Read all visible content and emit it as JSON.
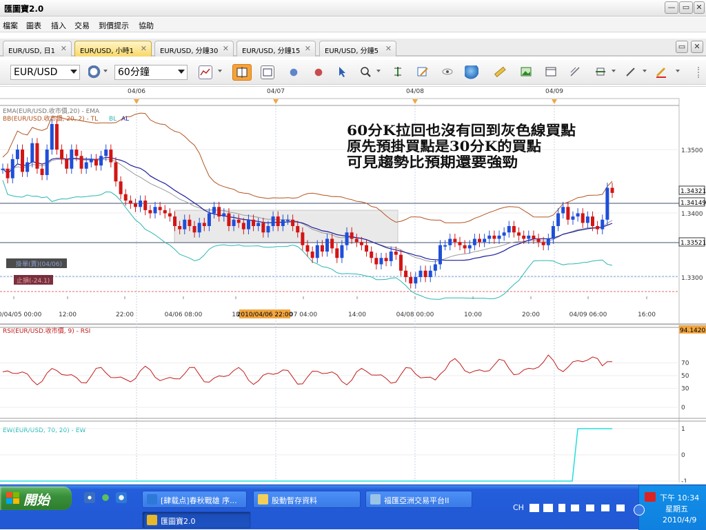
{
  "window": {
    "title": "匯圖寶2.0"
  },
  "menu": [
    "檔案",
    "圖表",
    "插入",
    "交易",
    "到價提示",
    "協助"
  ],
  "tabs": [
    {
      "label": "EUR/USD, 日1",
      "active": false
    },
    {
      "label": "EUR/USD, 小時1",
      "active": true
    },
    {
      "label": "EUR/USD, 分鐘30",
      "active": false
    },
    {
      "label": "EUR/USD, 分鐘15",
      "active": false
    },
    {
      "label": "EUR/USD, 分鐘5",
      "active": false
    }
  ],
  "toolbar": {
    "symbol": "EUR/USD",
    "period": "60分鐘"
  },
  "chart": {
    "top_dates": [
      "04/06",
      "04/07",
      "04/08",
      "04/09"
    ],
    "legend_ema": "EMA(EUR/USD.收市價,20) - EMA",
    "legend_bb": "BB(EUR/USD.收市價, 20, 2) - TL",
    "legend_bb_bl": "BL",
    "legend_bb_al": "AL",
    "annotation": [
      "60分K拉回也沒有回到灰色線買點",
      "原先預掛買點是30分K的買點",
      "可見趨勢比預期還要強勁"
    ],
    "price_ticks": [
      "1.3500",
      "1.3400",
      "1.3300"
    ],
    "price_labels": [
      "1.34321",
      "1.34149",
      "1.33521"
    ],
    "order_labels": [
      "掛單(賣)(04/06)",
      "止損(-24.1)"
    ],
    "x_ticks": [
      "2010/04/05 00:00",
      "12:00",
      "22:00",
      "04/06 08:00",
      "18",
      "07 04:00",
      "14:00",
      "04/08 00:00",
      "10:00",
      "20:00",
      "04/09 06:00",
      "16:00"
    ],
    "x_highlight": "2010/04/06 22:00",
    "rsi_legend": "RSI(EUR/USD.收市價, 9) - RSI",
    "rsi_value": "94.14205",
    "rsi_ticks": [
      "70",
      "50",
      "30",
      "0"
    ],
    "ew_legend": "EW(EUR/USD, 70, 20) - EW",
    "ew_ticks": [
      "1",
      "0",
      "-1"
    ],
    "colors": {
      "up": "#1f4fd8",
      "down": "#d21515",
      "ema": "#9a9a9a",
      "bb_mid": "#b2541e",
      "bb_mid_line": "#1c1c9c",
      "bb_low": "#2bb6b0",
      "rsi": "#c21a1a",
      "ew": "#22dddd"
    }
  },
  "chart_data": [
    {
      "type": "candlestick",
      "title": "EUR/USD 小時1",
      "x_range": [
        "2010/04/05 00:00",
        "2010/04/09 16:00"
      ],
      "ylim": [
        1.325,
        1.36
      ],
      "ohlc_note": "hourly candles",
      "series": [
        {
          "name": "EMA(EUR/USD.收市價,20)"
        },
        {
          "name": "BB(EUR/USD.收市價, 20, 2)"
        }
      ],
      "horizontal_lines": [
        1.34149,
        1.33521
      ]
    },
    {
      "type": "line",
      "title": "RSI(EUR/USD.收市價, 9)",
      "ylim": [
        0,
        100
      ],
      "last_value": 94.14205
    },
    {
      "type": "line",
      "title": "EW(EUR/USD, 70, 20)",
      "ylim": [
        -1,
        1
      ]
    }
  ],
  "taskbar": {
    "start": "開始",
    "tasks": [
      "[肆载点]春秋戰雄 序...",
      "股動暫存資料",
      "福匯亞洲交易平台II",
      "匯圖寶2.0"
    ],
    "tray": {
      "lang": "CH",
      "time": "下午 10:34",
      "day": "星期五",
      "date": "2010/4/9"
    }
  }
}
